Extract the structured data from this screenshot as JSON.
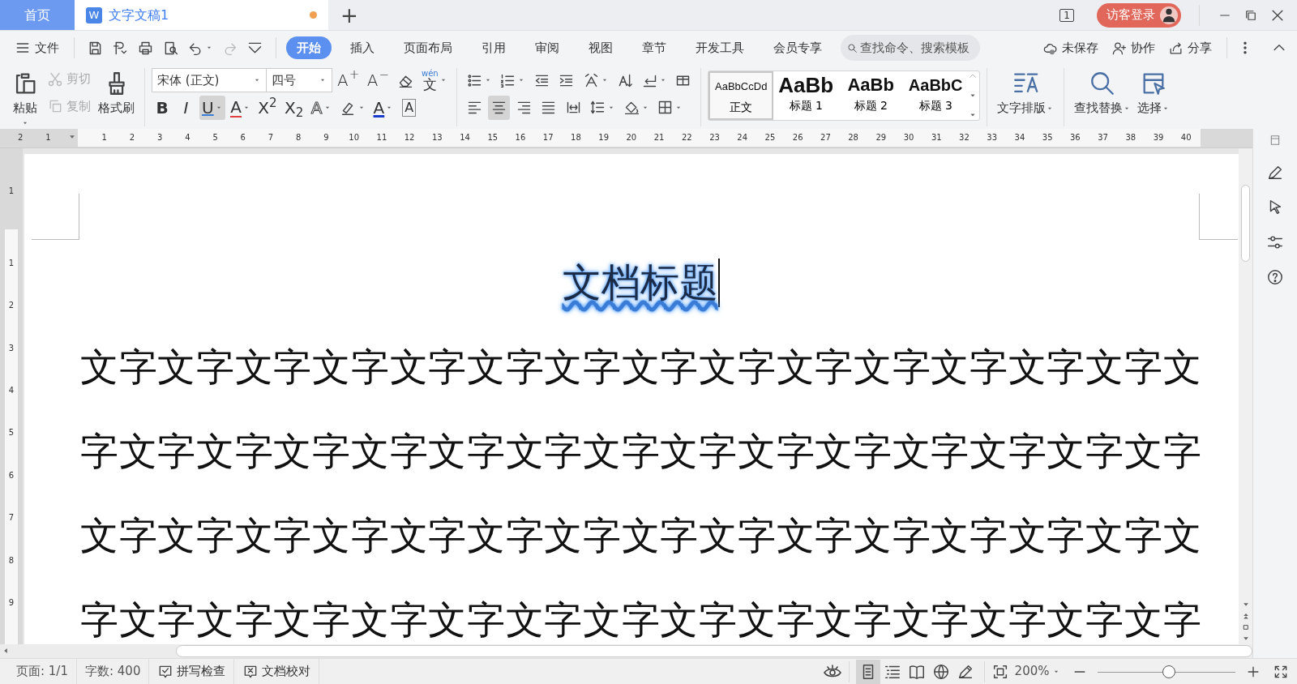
{
  "title_bar": {
    "tabs": [
      {
        "label": "首页",
        "kind": "home",
        "selected": false
      },
      {
        "label": "文字文稿1",
        "kind": "doc",
        "badge": "W",
        "selected": true,
        "unsaved": true
      }
    ],
    "new_tab": "+",
    "page_count": "1",
    "login_button": "访客登录"
  },
  "menu_bar": {
    "file": "文件",
    "quick_tools": [
      {
        "kind": "save",
        "disabled": false
      },
      {
        "kind": "export",
        "disabled": false
      },
      {
        "kind": "print",
        "disabled": false
      },
      {
        "kind": "preview",
        "disabled": false
      },
      {
        "kind": "undo",
        "disabled": false,
        "dropdown": true
      },
      {
        "kind": "redo",
        "disabled": true,
        "dropdown": false
      },
      {
        "kind": "customize",
        "disabled": false,
        "dropdown": false
      }
    ],
    "ribbon_tabs": [
      {
        "label": "开始",
        "selected": true
      },
      {
        "label": "插入",
        "selected": false
      },
      {
        "label": "页面布局",
        "selected": false
      },
      {
        "label": "引用",
        "selected": false
      },
      {
        "label": "审阅",
        "selected": false
      },
      {
        "label": "视图",
        "selected": false
      },
      {
        "label": "章节",
        "selected": false
      },
      {
        "label": "开发工具",
        "selected": false
      },
      {
        "label": "会员专享",
        "selected": false
      }
    ],
    "search": {
      "placeholder": "查找命令、搜索模板"
    },
    "actions": [
      {
        "label": "未保存",
        "kind": "cloud"
      },
      {
        "label": "协作",
        "kind": "collab"
      },
      {
        "label": "分享",
        "kind": "share"
      }
    ]
  },
  "ribbon": {
    "paste": "粘贴",
    "cut": {
      "label": "剪切",
      "disabled": true
    },
    "copy": {
      "label": "复制",
      "disabled": true
    },
    "format_painter": "格式刷",
    "font": {
      "value": "宋体 (正文)"
    },
    "font_size": {
      "value": "四号"
    },
    "font_tools": [
      {
        "kind": "grow",
        "glyph": "A$^{+}$"
      },
      {
        "kind": "shrink",
        "glyph": "A$^{−}$"
      },
      {
        "kind": "clear"
      },
      {
        "kind": "pinyin",
        "ruby": "wén",
        "glyph": "文"
      }
    ],
    "format_buttons": [
      {
        "kind": "bold",
        "glyph": "B",
        "selected": false,
        "dropdown": false
      },
      {
        "kind": "italic",
        "glyph": "I",
        "selected": false,
        "dropdown": false
      },
      {
        "kind": "underline",
        "glyph": "U",
        "selected": true,
        "dropdown": true
      },
      {
        "kind": "strike",
        "glyph": "A",
        "selected": false,
        "dropdown": true
      },
      {
        "kind": "sup",
        "glyph": "X$^{2}$",
        "selected": false,
        "dropdown": false
      },
      {
        "kind": "sub",
        "glyph": "X$_{2}$",
        "selected": false,
        "dropdown": false
      },
      {
        "kind": "effect",
        "glyph": "A",
        "selected": false,
        "dropdown": true
      },
      {
        "kind": "highlight",
        "selected": false,
        "dropdown": true
      },
      {
        "kind": "color",
        "glyph": "A",
        "selected": false,
        "dropdown": true
      },
      {
        "kind": "charborder",
        "glyph": "A",
        "selected": false,
        "dropdown": false
      }
    ],
    "paragraph_row_1": [
      {
        "kind": "bullets",
        "selected": false,
        "dropdown": true
      },
      {
        "kind": "numbering",
        "selected": false,
        "dropdown": true
      },
      {
        "kind": "outdent",
        "selected": false,
        "dropdown": false
      },
      {
        "kind": "indent",
        "selected": false,
        "dropdown": false
      },
      {
        "kind": "cjk-layout",
        "selected": false,
        "dropdown": true
      },
      {
        "kind": "sort",
        "selected": false,
        "dropdown": false
      },
      {
        "kind": "marks",
        "selected": false,
        "dropdown": true
      },
      {
        "kind": "table",
        "selected": false,
        "dropdown": false
      }
    ],
    "paragraph_row_2": [
      {
        "kind": "align-left",
        "selected": false,
        "dropdown": false
      },
      {
        "kind": "align-center",
        "selected": true,
        "dropdown": false
      },
      {
        "kind": "align-right",
        "selected": false,
        "dropdown": false
      },
      {
        "kind": "justify",
        "selected": false,
        "dropdown": false
      },
      {
        "kind": "distribute",
        "selected": false,
        "dropdown": false
      },
      {
        "kind": "line-spacing",
        "selected": false,
        "dropdown": true
      },
      {
        "kind": "shading",
        "selected": false,
        "dropdown": true
      },
      {
        "kind": "borders",
        "selected": false,
        "dropdown": true
      }
    ],
    "styles": [
      {
        "preview": "AaBbCcDd",
        "label": "正文",
        "kind": "normal",
        "selected": true
      },
      {
        "preview": "AaBb",
        "label": "标题 1",
        "kind": "h1",
        "selected": false
      },
      {
        "preview": "AaBb",
        "label": "标题 2",
        "kind": "h2",
        "selected": false
      },
      {
        "preview": "AaBbC",
        "label": "标题 3",
        "kind": "h3",
        "selected": false
      }
    ],
    "big_buttons": [
      {
        "label": "文字排版",
        "kind": "layout"
      },
      {
        "label": "查找替换",
        "kind": "find"
      },
      {
        "label": "选择",
        "kind": "select"
      }
    ]
  },
  "ruler": {
    "left_labels": [
      "2",
      "1"
    ],
    "labels": [
      "1",
      "2",
      "3",
      "4",
      "5",
      "6",
      "7",
      "8",
      "9",
      "10",
      "11",
      "12",
      "13",
      "14",
      "15",
      "16",
      "17",
      "18",
      "19",
      "20",
      "21",
      "22",
      "23",
      "24",
      "25",
      "26",
      "27",
      "28",
      "29",
      "30",
      "31",
      "32",
      "33",
      "34",
      "35",
      "36",
      "37",
      "38",
      "39",
      "40"
    ]
  },
  "vertical_ruler": {
    "top_labels": [
      "1"
    ],
    "labels": [
      "1",
      "2",
      "3",
      "4",
      "5",
      "6",
      "7",
      "8",
      "9"
    ]
  },
  "document": {
    "title": "文档标题",
    "title_selected": true,
    "spell_error": true,
    "lines": [
      "文字文字文字文字文字文字文字文字文字文字文字文字文字文字文",
      "字文字文字文字文字文字文字文字文字文字文字文字文字文字文字",
      "文字文字文字文字文字文字文字文字文字文字文字文字文字文字文",
      "字文字文字文字文字文字文字文字文字文字文字文字文字文字文字"
    ]
  },
  "status_bar": {
    "page": "页面: 1/1",
    "word_count": "字数: 400",
    "spell_check": "拼写检查",
    "proofread": "文档校对",
    "views": [
      {
        "kind": "page",
        "selected": true
      },
      {
        "kind": "outline",
        "selected": false
      },
      {
        "kind": "read",
        "selected": false
      },
      {
        "kind": "web",
        "selected": false
      },
      {
        "kind": "write",
        "selected": false
      }
    ],
    "zoom": "200%",
    "zoom_slider": {
      "level": 0.52
    }
  }
}
